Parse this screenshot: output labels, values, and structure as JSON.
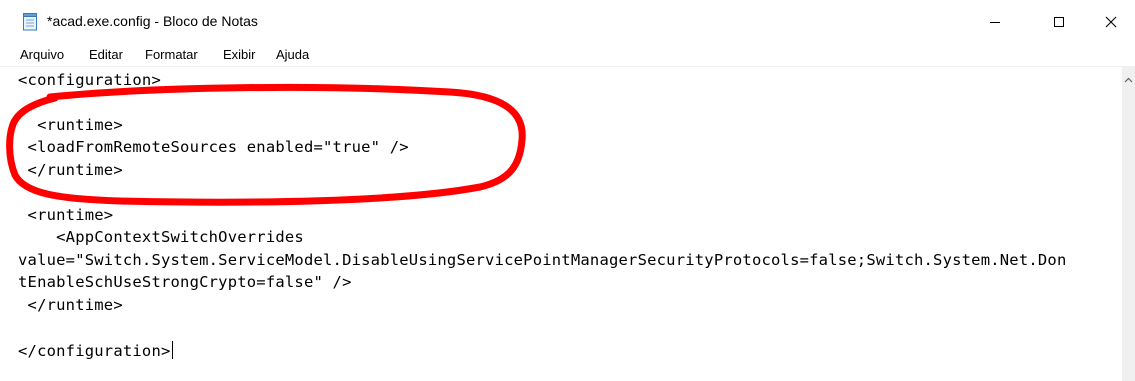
{
  "window": {
    "title": "*acad.exe.config - Bloco de Notas",
    "icon": "notepad-icon",
    "controls": [
      "minimize-icon",
      "maximize-icon",
      "close-icon"
    ]
  },
  "menu": {
    "arquivo": "Arquivo",
    "editar": "Editar",
    "formatar": "Formatar",
    "exibir": "Exibir",
    "ajuda": "Ajuda"
  },
  "editor": {
    "lines": [
      "<configuration>",
      "",
      "  <runtime>",
      " <loadFromRemoteSources enabled=\"true\" />",
      " </runtime>",
      "",
      " <runtime>",
      "    <AppContextSwitchOverrides",
      "value=\"Switch.System.ServiceModel.DisableUsingServicePointManagerSecurityProtocols=false;Switch.System.Net.Don",
      "tEnableSchUseStrongCrypto=false\" />",
      " </runtime>",
      "",
      "</configuration>"
    ]
  },
  "annotation": {
    "color": "#ff0000",
    "shape": "hand-drawn-ellipse"
  }
}
